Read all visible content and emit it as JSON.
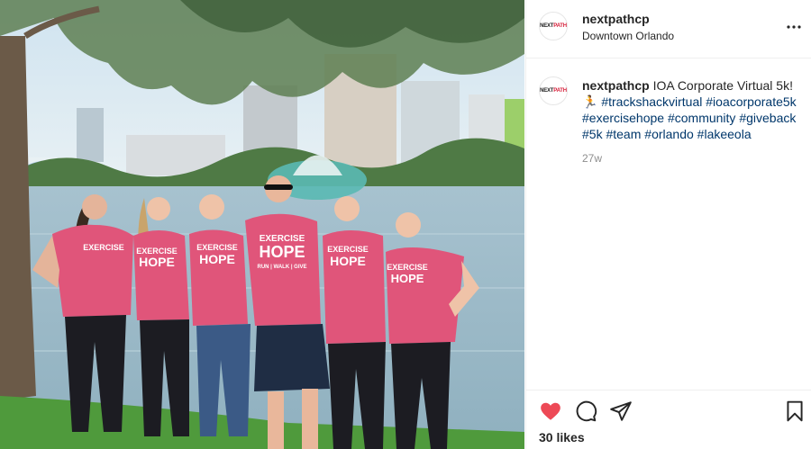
{
  "post": {
    "username": "nextpathcp",
    "location": "Downtown Orlando",
    "avatar": {
      "text_dark": "NEXT",
      "text_red": "PATH"
    },
    "caption": {
      "username": "nextpathcp",
      "text": "IOA Corporate Virtual 5k!",
      "emoji": "🏃",
      "hashtags": [
        "#trackshackvirtual",
        "#ioacorporate5k",
        "#exercisehope",
        "#community",
        "#giveback",
        "#5k",
        "#team",
        "#orlando",
        "#lakeeola"
      ]
    },
    "time_ago": "27w",
    "likes": "30 likes",
    "liked": true
  },
  "photo": {
    "shirt_text_line1": "EXERCISE",
    "shirt_text_line2": "HOPE",
    "shirt_text_line3": "RUN | WALK | GIVE"
  },
  "colors": {
    "like_red": "#ed4956",
    "hashtag": "#00376b",
    "muted": "#8e8e8e",
    "shirt_pink": "#e0557a"
  },
  "icons": [
    "more-options-icon",
    "heart-icon",
    "comment-icon",
    "share-icon",
    "bookmark-icon"
  ]
}
